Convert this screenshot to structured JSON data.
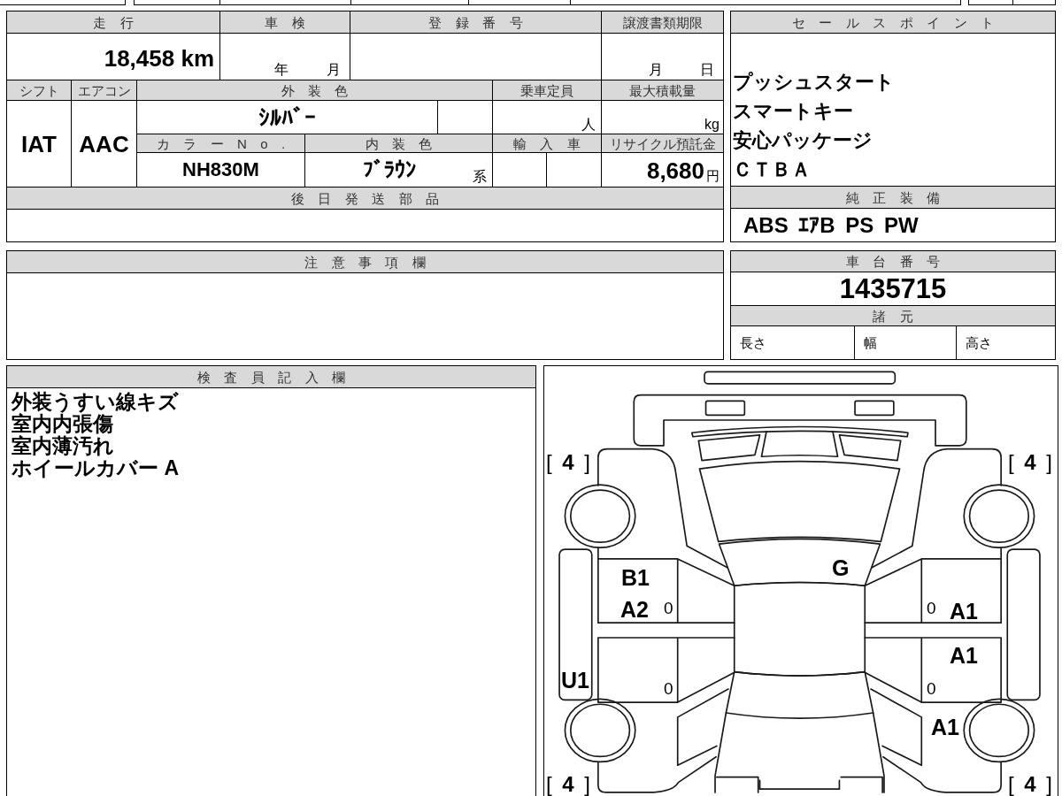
{
  "vehicle_table": {
    "mileage": {
      "label": "走 行",
      "value": "18,458 km"
    },
    "inspection": {
      "label": "車 検",
      "year_unit": "年",
      "month_unit": "月"
    },
    "registration_number": {
      "label": "登 録 番 号"
    },
    "transfer_document_deadline": {
      "label": "譲渡書類期限",
      "month_unit": "月",
      "day_unit": "日"
    },
    "shift": {
      "label": "シフト",
      "value": "IAT"
    },
    "air_conditioner": {
      "label": "エアコン",
      "value": "AAC"
    },
    "exterior_color": {
      "label": "外 装 色",
      "value": "ｼﾙﾊﾞｰ"
    },
    "seating_capacity": {
      "label": "乗車定員",
      "unit": "人"
    },
    "max_load": {
      "label": "最大積載量",
      "unit": "kg"
    },
    "color_number": {
      "label": "カ ラ ー N o .",
      "value": "NH830M"
    },
    "interior_color": {
      "label": "内 装 色",
      "value": "ﾌﾞﾗｳﾝ",
      "suffix": "系"
    },
    "imported": {
      "label": "輸 入 車"
    },
    "recycling_deposit": {
      "label": "リサイクル預託金",
      "value": "8,680",
      "unit": "円"
    },
    "parts_shipped_later": {
      "label": "後 日 発 送 部 品"
    }
  },
  "sales_points": {
    "label": "セ ー ル ス ポ イ ン ト",
    "items": [
      "プッシュスタート",
      "スマートキー",
      "安心パッケージ",
      "ＣＴＢＡ"
    ]
  },
  "standard_equipment": {
    "label": "純 正 装 備",
    "value": "ABS ｴｱB PS PW"
  },
  "notes": {
    "label": "注 意 事 項 欄"
  },
  "chassis_number": {
    "label": "車 台 番 号",
    "value": "1435715"
  },
  "specifications": {
    "label": "諸 元",
    "fields": [
      "長さ",
      "幅",
      "高さ"
    ]
  },
  "inspector_notes": {
    "label": "検 査 員 記 入 欄",
    "lines": [
      "外装うすい線キズ",
      "室内内張傷",
      "室内薄汚れ",
      "ホイールカバー A"
    ]
  },
  "damage_diagram": {
    "tire_labels": [
      "[ **4** ]",
      "[ **4** ]",
      "[ **4** ]",
      "[ **4** ]"
    ],
    "damage_codes": [
      "B1",
      "A2",
      "G",
      "A1",
      "A1",
      "U1",
      "A1"
    ],
    "door_marks": [
      "0",
      "0",
      "0",
      "0"
    ]
  }
}
